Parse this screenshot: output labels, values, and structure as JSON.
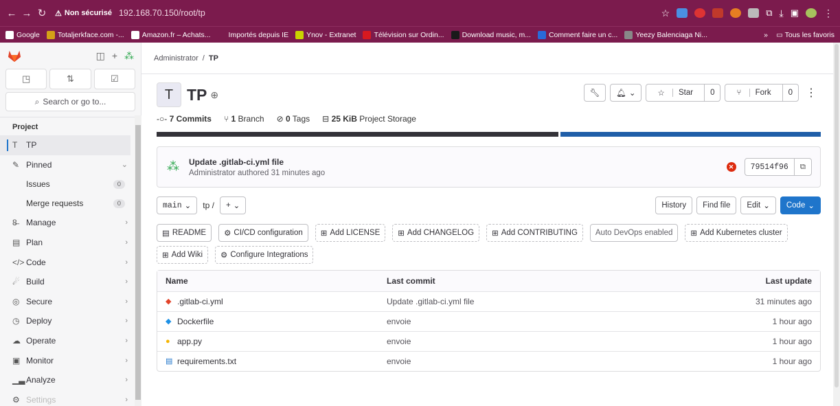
{
  "browser": {
    "security_label": "Non sécurisé",
    "url": "192.168.70.150/root/tp",
    "bookmarks": [
      {
        "label": "Google",
        "color": "#ffffff"
      },
      {
        "label": "Totaljerkface.com -...",
        "color": "#d4a017"
      },
      {
        "label": "Amazon.fr – Achats...",
        "color": "#ffffff"
      },
      {
        "label": "Importés depuis IE",
        "color": "#7b1b4d"
      },
      {
        "label": "Ynov - Extranet",
        "color": "#c9d300"
      },
      {
        "label": "Télévision sur Ordin...",
        "color": "#d71920"
      },
      {
        "label": "Download music, m...",
        "color": "#1a1a1a"
      },
      {
        "label": "Comment faire un c...",
        "color": "#2a6ad8"
      },
      {
        "label": "Yeezy Balenciaga Ni...",
        "color": "#888888"
      }
    ],
    "bookmarks_overflow": "»",
    "all_bookmarks": "Tous les favoris"
  },
  "sidebar": {
    "search_placeholder": "Search or go to...",
    "section_title": "Project",
    "project_avatar": "T",
    "project_name": "TP",
    "pinned": "Pinned",
    "pinned_items": [
      {
        "label": "Issues",
        "count": "0"
      },
      {
        "label": "Merge requests",
        "count": "0"
      }
    ],
    "items": [
      {
        "label": "Manage",
        "icon": "users-icon",
        "glyph": "8̶"
      },
      {
        "label": "Plan",
        "icon": "calendar-icon",
        "glyph": "▤"
      },
      {
        "label": "Code",
        "icon": "code-icon",
        "glyph": "</>"
      },
      {
        "label": "Build",
        "icon": "rocket-icon",
        "glyph": "☄"
      },
      {
        "label": "Secure",
        "icon": "shield-icon",
        "glyph": "◎"
      },
      {
        "label": "Deploy",
        "icon": "deploy-icon",
        "glyph": "◷"
      },
      {
        "label": "Operate",
        "icon": "cloud-icon",
        "glyph": "☁"
      },
      {
        "label": "Monitor",
        "icon": "monitor-icon",
        "glyph": "▣"
      },
      {
        "label": "Analyze",
        "icon": "chart-icon",
        "glyph": "▁▃"
      },
      {
        "label": "Settings",
        "icon": "gear-icon",
        "glyph": "⚙"
      }
    ]
  },
  "breadcrumb": {
    "parent": "Administrator",
    "separator": "/",
    "current": "TP"
  },
  "project": {
    "avatar": "T",
    "name": "TP",
    "star_label": "Star",
    "star_count": "0",
    "fork_label": "Fork",
    "fork_count": "0"
  },
  "stats": {
    "commits_num": "7",
    "commits_label": "Commits",
    "branch_num": "1",
    "branch_label": "Branch",
    "tags_num": "0",
    "tags_label": "Tags",
    "storage_num": "25 KiB",
    "storage_label": "Project Storage"
  },
  "language_bar": [
    0.607,
    0.393
  ],
  "last_commit": {
    "title": "Update .gitlab-ci.yml file",
    "author": "Administrator",
    "authored_text": "authored",
    "time": "31 minutes ago",
    "sha": "79514f96",
    "pipeline_status": "failed"
  },
  "toolbar": {
    "branch": "main",
    "path": "tp",
    "path_separator": "/",
    "add": "+",
    "history": "History",
    "find_file": "Find file",
    "edit": "Edit",
    "code": "Code"
  },
  "quick_actions": [
    {
      "label": "README",
      "style": "solid"
    },
    {
      "label": "CI/CD configuration",
      "style": "solid"
    },
    {
      "label": "Add LICENSE",
      "style": "dashed"
    },
    {
      "label": "Add CHANGELOG",
      "style": "dashed"
    },
    {
      "label": "Add CONTRIBUTING",
      "style": "dashed"
    },
    {
      "label": "Auto DevOps enabled",
      "style": "muted"
    },
    {
      "label": "Add Kubernetes cluster",
      "style": "dashed"
    },
    {
      "label": "Add Wiki",
      "style": "dashed"
    },
    {
      "label": "Configure Integrations",
      "style": "dashed"
    }
  ],
  "table": {
    "headers": [
      "Name",
      "Last commit",
      "Last update"
    ],
    "rows": [
      {
        "name": ".gitlab-ci.yml",
        "icon": "gitlab-icon",
        "commit": "Update .gitlab-ci.yml file",
        "updated": "31 minutes ago"
      },
      {
        "name": "Dockerfile",
        "icon": "docker-icon",
        "commit": "envoie",
        "updated": "1 hour ago"
      },
      {
        "name": "app.py",
        "icon": "python-icon",
        "commit": "envoie",
        "updated": "1 hour ago"
      },
      {
        "name": "requirements.txt",
        "icon": "text-file-icon",
        "commit": "envoie",
        "updated": "1 hour ago"
      }
    ]
  },
  "colors": {
    "browser_chrome": "#7b1b4d",
    "primary": "#1f75cb",
    "failed": "#dd2b0e"
  }
}
